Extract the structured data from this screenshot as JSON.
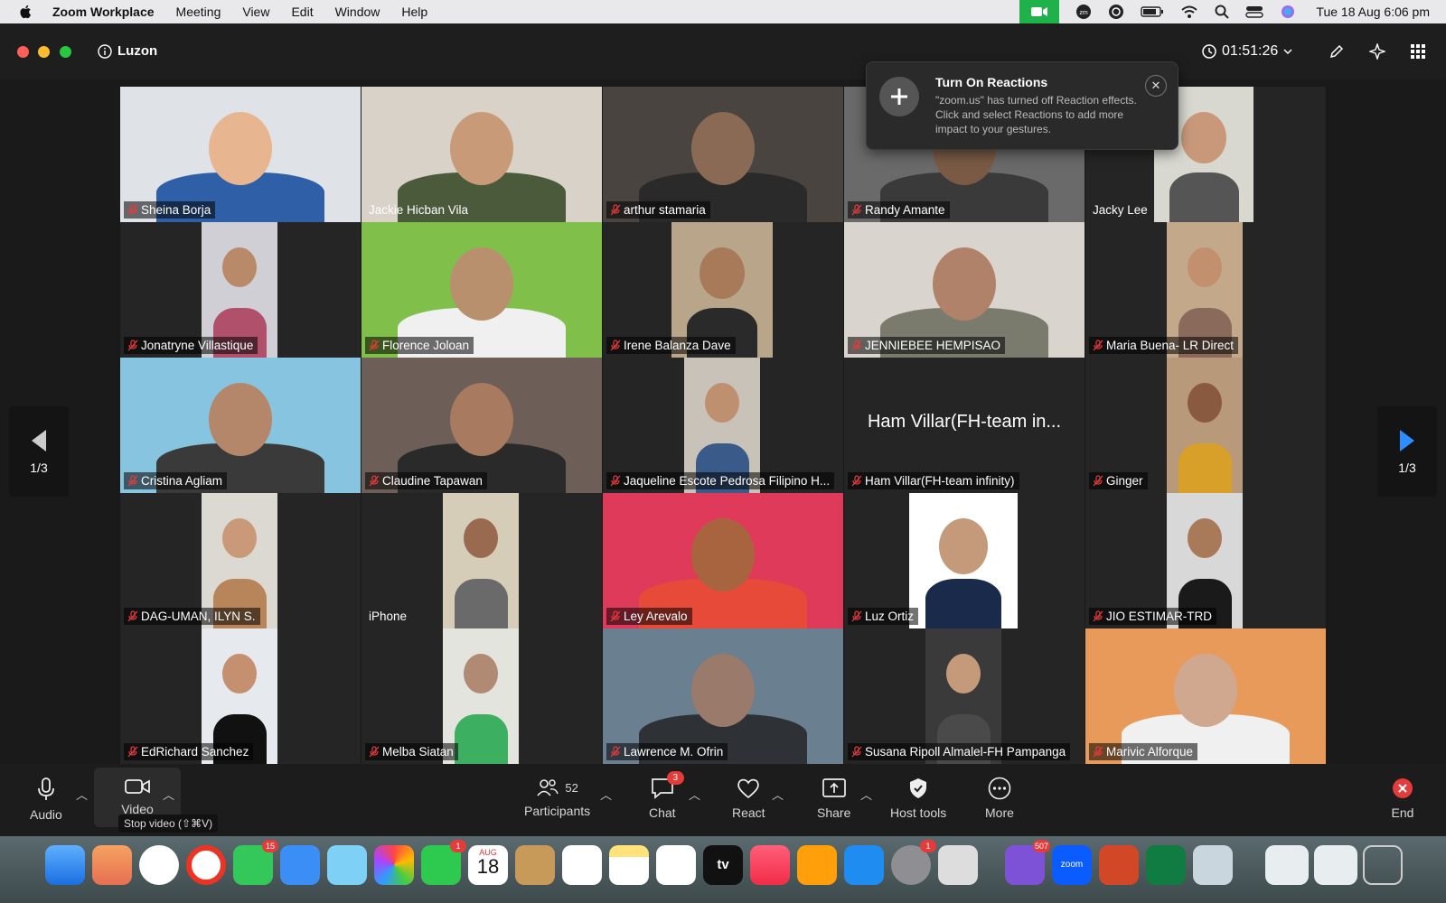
{
  "menubar": {
    "app_name": "Zoom Workplace",
    "menus": [
      "Meeting",
      "View",
      "Edit",
      "Window",
      "Help"
    ],
    "datetime": "Tue 18 Aug  6:06 pm"
  },
  "window": {
    "meeting_name": "Luzon",
    "timer": "01:51:26"
  },
  "reactions_popup": {
    "title": "Turn On Reactions",
    "message": "\"zoom.us\" has turned off Reaction effects. Click  and select Reactions to add more impact to your gestures."
  },
  "pager": {
    "left_label": "1/3",
    "right_label": "1/3"
  },
  "participants": [
    {
      "name": "Sheina Borja",
      "muted": true
    },
    {
      "name": "Jackie Hicban Vila",
      "muted": false,
      "speaking": true
    },
    {
      "name": "arthur stamaria",
      "muted": true
    },
    {
      "name": "Randy Amante",
      "muted": true
    },
    {
      "name": "Jacky Lee",
      "muted": false
    },
    {
      "name": "Jonatryne Villastique",
      "muted": true
    },
    {
      "name": "Florence Joloan",
      "muted": true
    },
    {
      "name": "Irene Balanza Dave",
      "muted": true
    },
    {
      "name": "JENNIEBEE HEMPISAO",
      "muted": true
    },
    {
      "name": "Maria  Buena- LR Direct",
      "muted": true
    },
    {
      "name": "Cristina Agliam",
      "muted": true
    },
    {
      "name": "Claudine Tapawan",
      "muted": true
    },
    {
      "name": "Jaqueline Escote Pedrosa Filipino H...",
      "muted": true
    },
    {
      "name": "Ham Villar(FH-team infinity)",
      "muted": true,
      "video_off_label": "Ham Villar(FH-team in..."
    },
    {
      "name": "Ginger",
      "muted": true
    },
    {
      "name": "DAG-UMAN, ILYN S.",
      "muted": true
    },
    {
      "name": "iPhone",
      "muted": false
    },
    {
      "name": "Ley Arevalo",
      "muted": true
    },
    {
      "name": "Luz Ortiz",
      "muted": true
    },
    {
      "name": "JIO ESTIMAR-TRD",
      "muted": true
    },
    {
      "name": "EdRichard Sanchez",
      "muted": true
    },
    {
      "name": "Melba Siatan",
      "muted": true
    },
    {
      "name": "Lawrence M. Ofrin",
      "muted": true
    },
    {
      "name": "Susana Ripoll Almalel-FH Pampanga",
      "muted": true
    },
    {
      "name": "Marivic Alforque",
      "muted": true
    }
  ],
  "toolbar": {
    "audio": "Audio",
    "video": "Video",
    "participants": "Participants",
    "participants_count": "52",
    "chat": "Chat",
    "chat_badge": "3",
    "react": "React",
    "share": "Share",
    "host_tools": "Host tools",
    "more": "More",
    "end": "End"
  },
  "tooltip": "Stop video (⇧⌘V)",
  "dock": {
    "badges": {
      "messages": "15",
      "facetime": "1",
      "calendar_month": "AUG",
      "calendar_day": "18",
      "settings": "1",
      "viber": "507"
    },
    "appletv_label": "tv",
    "zoom_label": "zoom"
  },
  "colors": {
    "speaking": "#38d430",
    "mute": "#e53b3b",
    "zoom_green": "#1fb24b",
    "pager_arrow": "#2d8cff"
  }
}
